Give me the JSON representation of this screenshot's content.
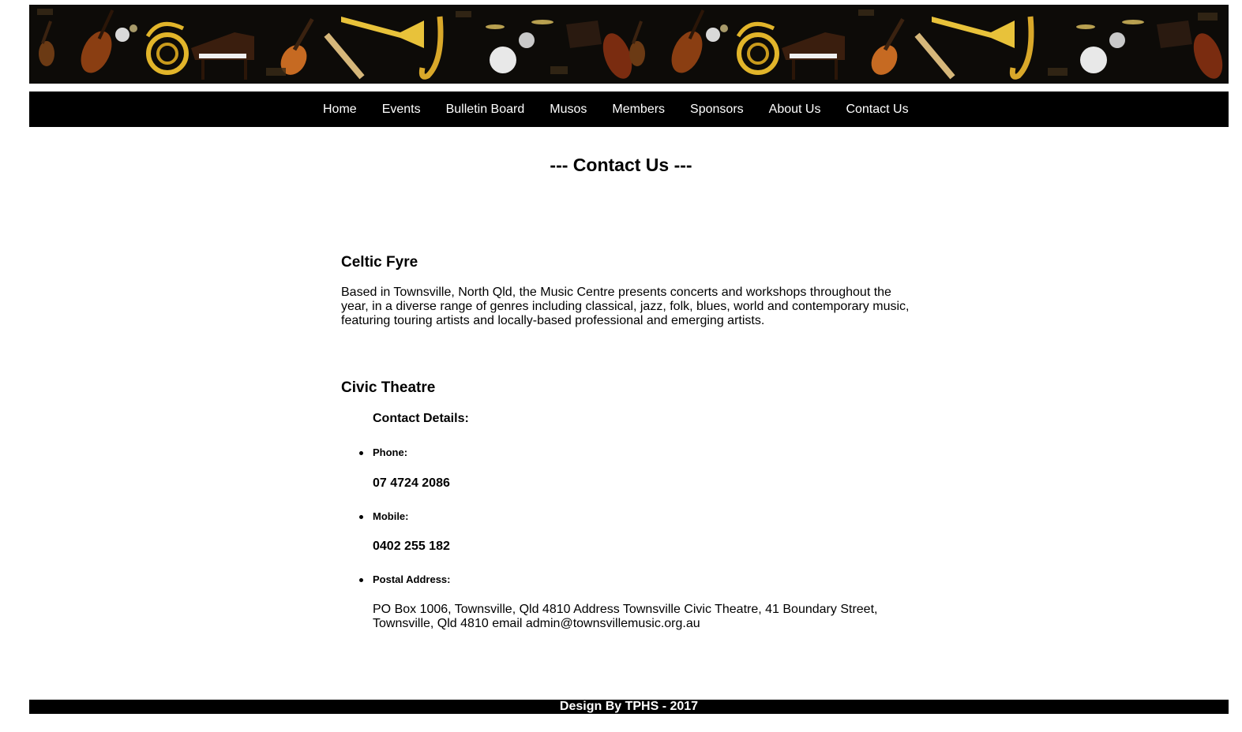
{
  "banner": {
    "alt": "Musical instruments banner",
    "bg_color": "#0d0b08"
  },
  "nav": {
    "items": [
      {
        "label": "Home"
      },
      {
        "label": "Events"
      },
      {
        "label": "Bulletin Board"
      },
      {
        "label": "Musos"
      },
      {
        "label": "Members"
      },
      {
        "label": "Sponsors"
      },
      {
        "label": "About Us"
      },
      {
        "label": "Contact Us"
      }
    ]
  },
  "page": {
    "title": "--- Contact Us ---"
  },
  "celtic": {
    "heading": "Celtic Fyre",
    "description": "Based in Townsville, North Qld, the Music Centre presents concerts and workshops throughout the year, in a diverse range of genres including classical, jazz, folk, blues, world and contemporary music, featuring touring artists and locally-based professional and emerging artists."
  },
  "civic": {
    "heading": "Civic Theatre",
    "contact_details_label": "Contact Details:",
    "phone_label": "Phone:",
    "phone_value": "07 4724 2086",
    "mobile_label": "Mobile:",
    "mobile_value": "0402 255 182",
    "postal_label": "Postal Address:",
    "postal_value": "PO Box 1006, Townsville, Qld 4810 Address Townsville Civic Theatre, 41 Boundary Street, Townsville, Qld 4810 email admin@townsvillemusic.org.au"
  },
  "footer": {
    "text": "Design By TPHS - 2017"
  }
}
